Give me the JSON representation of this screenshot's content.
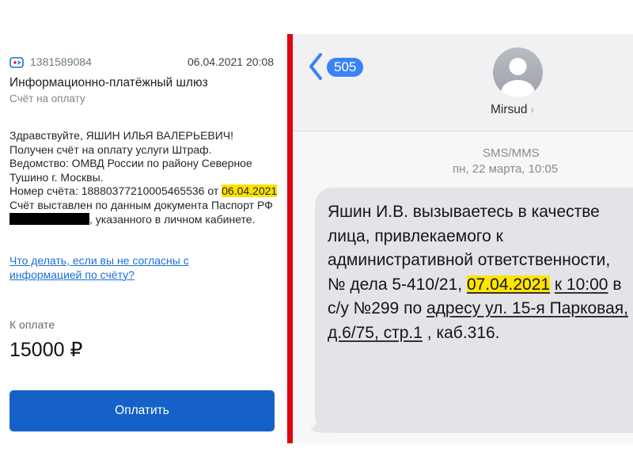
{
  "left_panel": {
    "sender_id": "1381589084",
    "datetime": "06.04.2021 20:08",
    "title": "Информационно-платёжный шлюз",
    "subtitle": "Счёт на оплату",
    "message": {
      "greeting": "Здравствуйте, ЯШИН ИЛЬЯ ВАЛЕРЬЕВИЧ!",
      "line_service": "Получен счёт на оплату услуги Штраф.",
      "line_department": "Ведомство: ОМВД России по району Северное Тушино г. Москвы.",
      "invoice_prefix": "Номер счёта: 18880377210005465536 от",
      "invoice_date": "06.04.2021",
      "doc_prefix": "Счёт выставлен по данным документа Паспорт РФ",
      "doc_suffix": ", указанного в личном кабинете."
    },
    "link_text": "Что делать, если вы не согласны с информацией по счёту?",
    "amount_label": "К оплате",
    "amount": "15000 ₽",
    "pay_button": "Оплатить"
  },
  "right_panel": {
    "back_badge": "505",
    "contact_name": "Mirsud",
    "contact_chevron": "›",
    "sms_type": "SMS/MMS",
    "sms_time": "пн, 22 марта, 10:05",
    "bubble": {
      "part1": "Яшин И.В. вызываетесь  в качестве лица, привлекаемого к административной ответственности, № дела ",
      "case_number": "5-410/21",
      "comma": ", ",
      "date": "07.04.2021",
      "space": " ",
      "time": "к 10:00",
      "part2": " в с/у №299 по ",
      "address": "адресу ул. 15-я Парковая, д.6/75, стр.1",
      "part3": " , каб.316."
    }
  },
  "colors": {
    "divider": "#e3000f",
    "pay_button": "#1561c8",
    "highlight": "#ffe400",
    "ios_blue": "#3b82f6"
  },
  "icons": [
    "gosuslugi-icon",
    "back-chevron-icon",
    "contact-avatar-icon",
    "chevron-right-icon"
  ]
}
